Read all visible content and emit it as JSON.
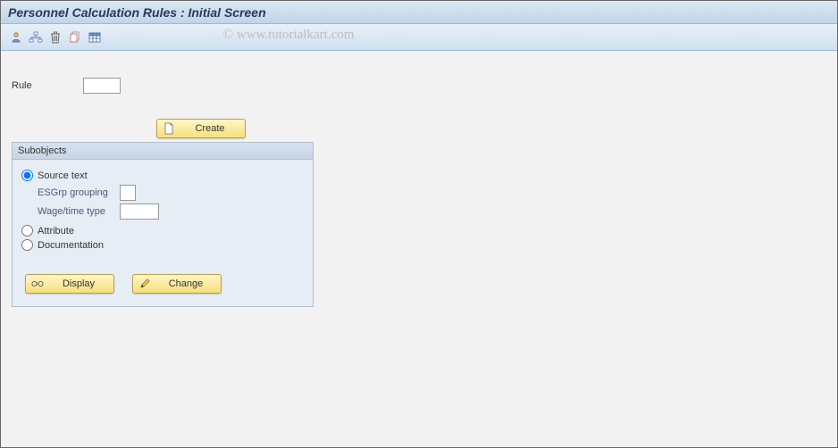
{
  "header": {
    "title": "Personnel Calculation Rules : Initial Screen"
  },
  "toolbar": {
    "icons": [
      "person-icon",
      "hierarchy-icon",
      "delete-icon",
      "copy-icon",
      "table-icon"
    ]
  },
  "fields": {
    "rule_label": "Rule",
    "rule_value": ""
  },
  "buttons": {
    "create_label": "Create",
    "display_label": "Display",
    "change_label": "Change"
  },
  "groupbox": {
    "title": "Subobjects",
    "radios": {
      "source_text": "Source text",
      "attribute": "Attribute",
      "documentation": "Documentation",
      "selected": "source_text"
    },
    "subfields": {
      "esgrp_label": "ESGrp grouping",
      "esgrp_value": "",
      "wagetime_label": "Wage/time type",
      "wagetime_value": ""
    }
  },
  "watermark": "www.tutorialkart.com"
}
